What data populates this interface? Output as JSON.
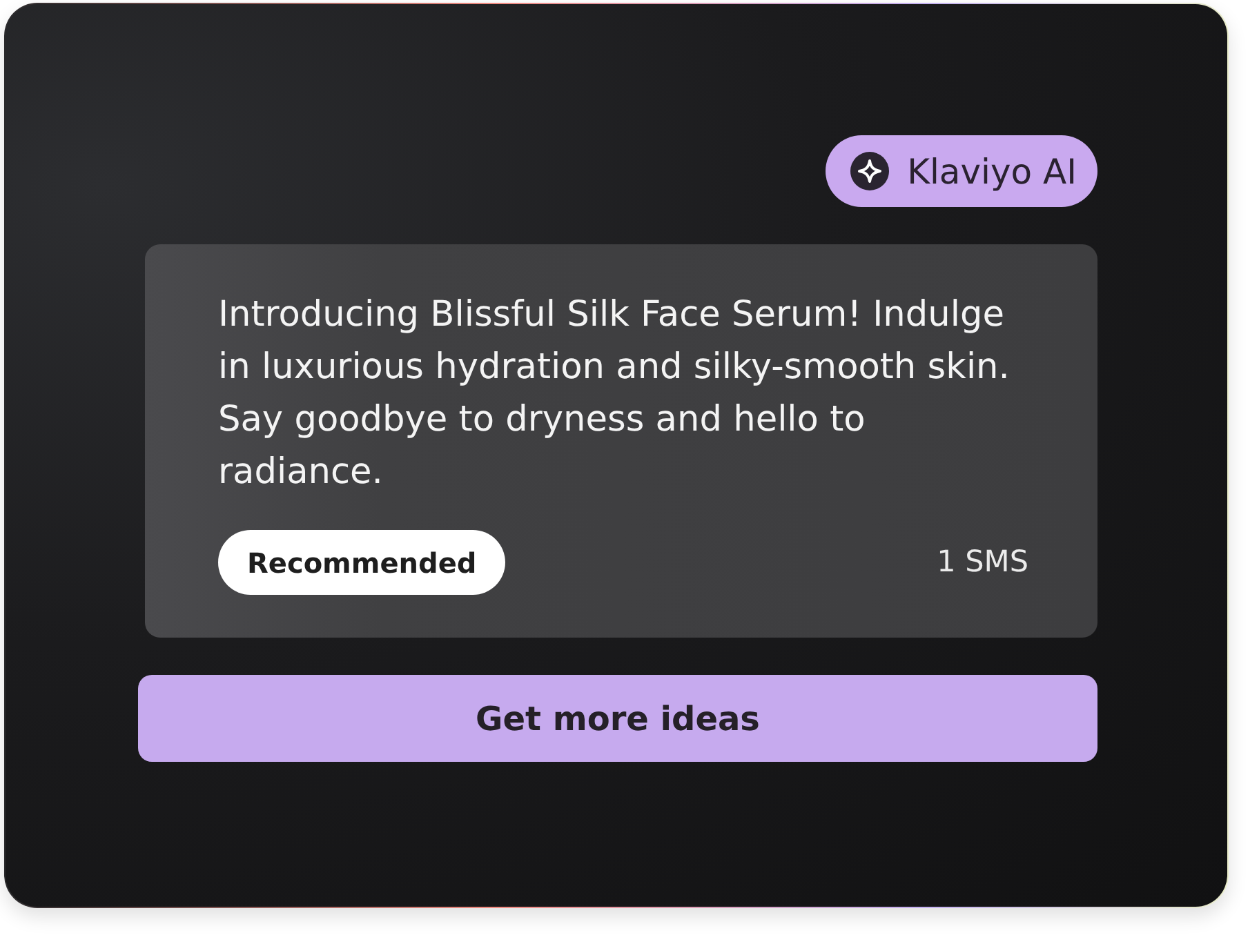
{
  "assistant_badge": {
    "label": "Klaviyo AI"
  },
  "suggestion": {
    "message": "Introducing Blissful Silk Face Serum! Indulge in luxurious hydration and silky-smooth skin. Say goodbye to dryness and hello to radiance.",
    "tag": {
      "label": "Recommended"
    },
    "segment_count": "1 SMS"
  },
  "action_button": {
    "label": "Get more ideas"
  }
}
